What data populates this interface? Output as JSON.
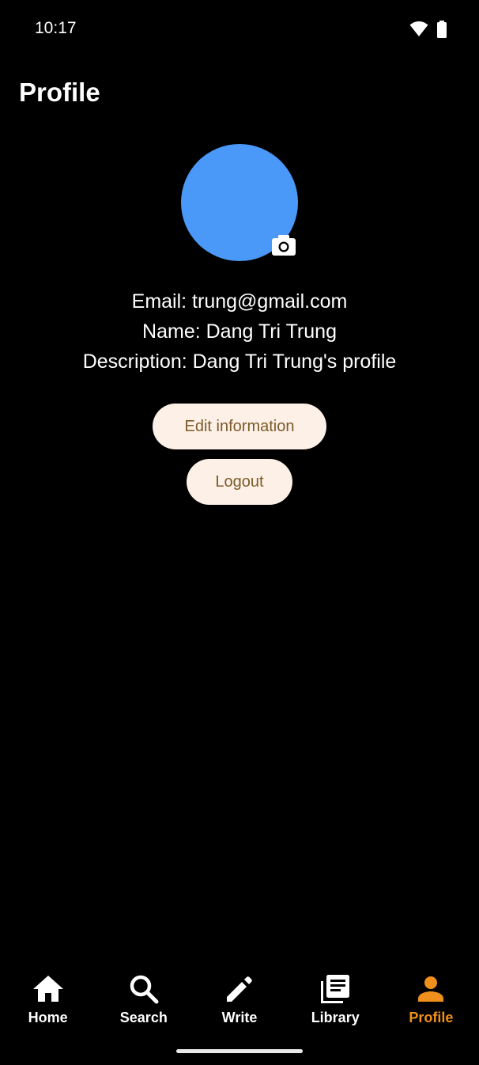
{
  "status_bar": {
    "time": "10:17",
    "icons": [
      "wifi-icon",
      "battery-icon"
    ]
  },
  "header": {
    "title": "Profile"
  },
  "profile": {
    "avatar_color": "#4a98f7",
    "email_line": "Email: trung@gmail.com",
    "name_line": "Name: Dang Tri Trung",
    "description_line": "Description: Dang Tri Trung's profile"
  },
  "actions": {
    "edit_label": "Edit information",
    "logout_label": "Logout"
  },
  "bottom_nav": {
    "active_color": "#f0901c",
    "items": [
      {
        "label": "Home",
        "icon": "home-icon"
      },
      {
        "label": "Search",
        "icon": "search-icon"
      },
      {
        "label": "Write",
        "icon": "pencil-icon"
      },
      {
        "label": "Library",
        "icon": "library-icon"
      },
      {
        "label": "Profile",
        "icon": "person-icon",
        "active": true
      }
    ]
  }
}
